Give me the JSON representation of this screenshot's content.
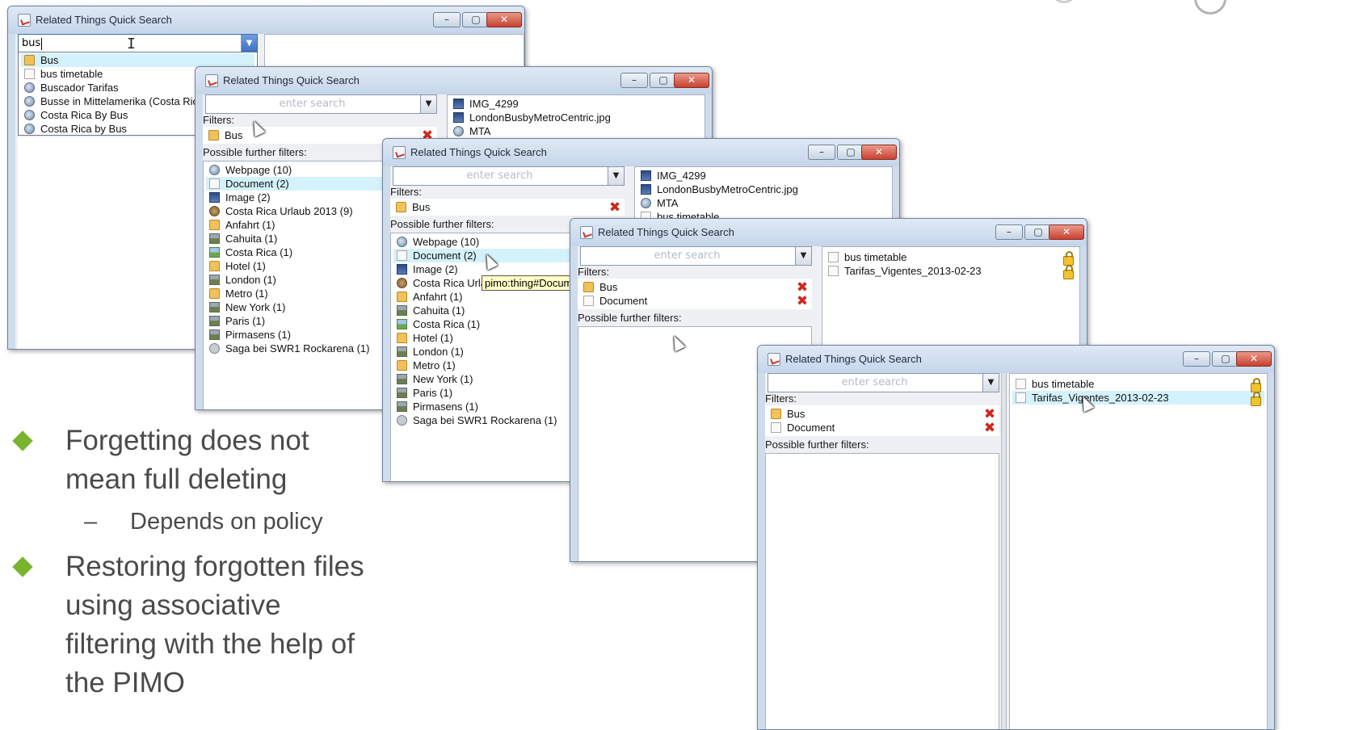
{
  "window_title": "Related Things Quick Search",
  "placeholder": "enter search",
  "labels": {
    "filters": "Filters:",
    "possible_filters": "Possible further filters:"
  },
  "win_controls": {
    "minimize": "–",
    "maximize": "▢",
    "close": "✕"
  },
  "win1": {
    "search_value": "bus",
    "suggestions": [
      {
        "icon": "folder-icon",
        "text": "Bus",
        "selected": true
      },
      {
        "icon": "document-icon",
        "text": "bus timetable"
      },
      {
        "icon": "webpage-icon",
        "text": "Buscador Tarifas"
      },
      {
        "icon": "webpage-icon",
        "text": "Busse in Mittelamerika (Costa Ric"
      },
      {
        "icon": "webpage-icon",
        "text": "Costa Rica By Bus"
      },
      {
        "icon": "webpage-icon",
        "text": "Costa Rica by Bus"
      }
    ]
  },
  "filter_facets": [
    {
      "icon": "webpage-icon",
      "text": "Webpage (10)"
    },
    {
      "icon": "document-icon",
      "text": "Document (2)"
    },
    {
      "icon": "image-icon",
      "text": "Image (2)"
    },
    {
      "icon": "earth-icon",
      "text": "Costa Rica Urlaub 2013 (9)"
    },
    {
      "icon": "folder-icon",
      "text": "Anfahrt (1)"
    },
    {
      "icon": "city-icon",
      "text": "Cahuita (1)"
    },
    {
      "icon": "landscape-icon",
      "text": "Costa Rica (1)"
    },
    {
      "icon": "folder-icon",
      "text": "Hotel (1)"
    },
    {
      "icon": "city-icon",
      "text": "London (1)"
    },
    {
      "icon": "folder-icon",
      "text": "Metro (1)"
    },
    {
      "icon": "city-icon",
      "text": "New York (1)"
    },
    {
      "icon": "city-icon",
      "text": "Paris (1)"
    },
    {
      "icon": "city-icon",
      "text": "Pirmasens (1)"
    },
    {
      "icon": "eye-icon",
      "text": "Saga bei SWR1 Rockarena (1)"
    }
  ],
  "results_bus": [
    {
      "icon": "image-icon",
      "text": "IMG_4299"
    },
    {
      "icon": "image-icon",
      "text": "LondonBusbyMetroCentric.jpg"
    },
    {
      "icon": "webpage-icon",
      "text": "MTA"
    },
    {
      "icon": "document-icon",
      "text": "bus timetable"
    }
  ],
  "win3": {
    "costa_rica_trunc": "Costa Rica Urla",
    "tooltip": "pimo:thing#Docum"
  },
  "active_filters": [
    "Bus",
    "Document"
  ],
  "results_doc": [
    "bus timetable",
    "Tarifas_Vigentes_2013-02-23"
  ],
  "slide": {
    "bullet1_line1": "Forgetting does not",
    "bullet1_line2": "mean full deleting",
    "sub_bullet": "Depends on policy",
    "sub_dash": "–",
    "bullet2_line1": "Restoring forgotten files",
    "bullet2_line2": "using associative",
    "bullet2_line3": "filtering with the help of",
    "bullet2_line4": "the PIMO"
  },
  "colors": {
    "selection": "#d4f2fb",
    "bullet_green": "#7ab32e",
    "remove_red": "#d1281d",
    "tooltip_bg": "#ffffc6"
  }
}
